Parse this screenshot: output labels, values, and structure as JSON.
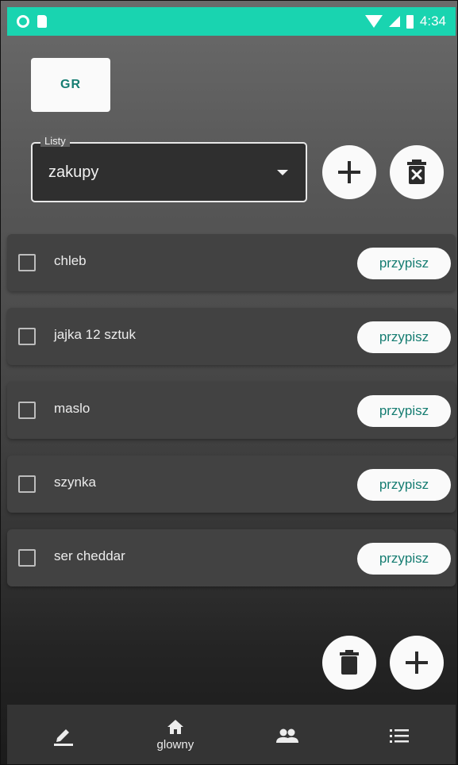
{
  "status_bar": {
    "time": "4:34"
  },
  "header": {
    "group_button_label": "GR"
  },
  "list_select": {
    "legend": "Listy",
    "selected": "zakupy"
  },
  "items": [
    {
      "label": "chleb",
      "checked": false,
      "action": "przypisz"
    },
    {
      "label": "jajka 12 sztuk",
      "checked": false,
      "action": "przypisz"
    },
    {
      "label": "maslo",
      "checked": false,
      "action": "przypisz"
    },
    {
      "label": "szynka",
      "checked": false,
      "action": "przypisz"
    },
    {
      "label": "ser cheddar",
      "checked": false,
      "action": "przypisz"
    }
  ],
  "bottom_nav": [
    {
      "icon": "pencil-icon",
      "label": ""
    },
    {
      "icon": "home-icon",
      "label": "glowny"
    },
    {
      "icon": "people-icon",
      "label": ""
    },
    {
      "icon": "list-icon",
      "label": ""
    }
  ],
  "colors": {
    "accent": "#19d4b0",
    "button_text": "#167d72"
  }
}
